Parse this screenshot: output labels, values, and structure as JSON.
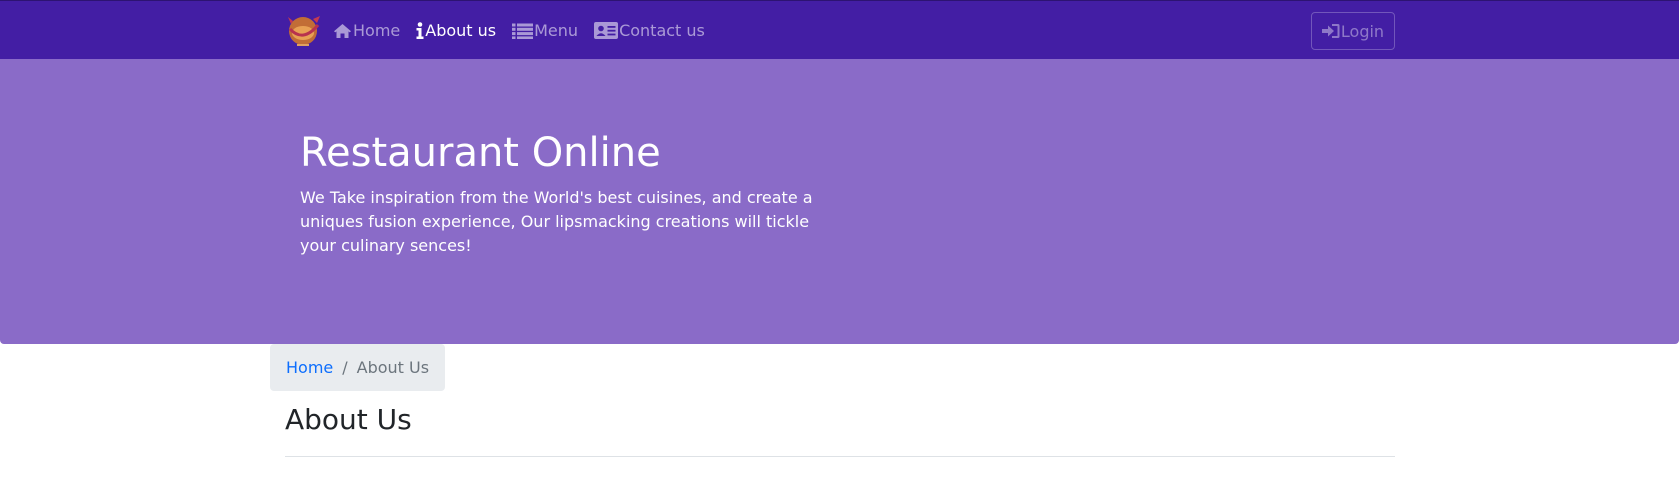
{
  "navbar": {
    "logo_icon": "restaurant-logo-icon",
    "bg_color": "#431ea4",
    "links": [
      {
        "label": "Home",
        "icon": "home-icon",
        "active": false
      },
      {
        "label": "About us",
        "icon": "info-icon",
        "active": true
      },
      {
        "label": "Menu",
        "icon": "list-icon",
        "active": false
      },
      {
        "label": "Contact us",
        "icon": "contact-card-icon",
        "active": false
      }
    ],
    "login": {
      "label": "Login",
      "icon": "sign-in-icon"
    }
  },
  "hero": {
    "title": "Restaurant Online",
    "text": "We Take inspiration from the World's best cuisines, and create a uniques fusion experience, Our lipsmacking creations will tickle your culinary sences!",
    "bg_color": "#8a6bc8"
  },
  "breadcrumb": {
    "home": "Home",
    "separator": "/",
    "current": "About Us"
  },
  "page": {
    "heading": "About Us"
  }
}
